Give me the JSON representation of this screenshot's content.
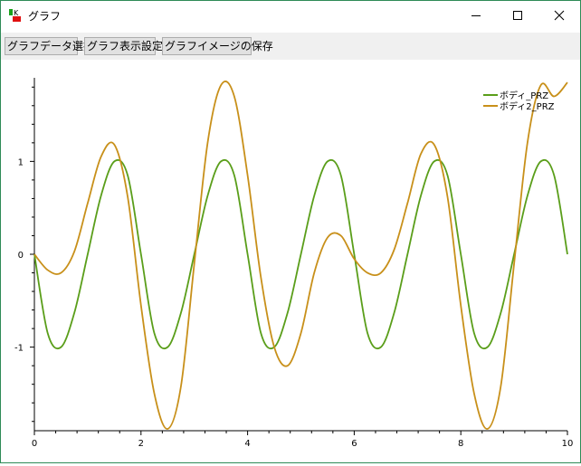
{
  "window": {
    "title": "グラフ",
    "controls": {
      "minimize_icon": "minimize-icon",
      "maximize_icon": "maximize-icon",
      "close_icon": "close-icon"
    }
  },
  "toolbar": {
    "select_data_label": "グラフデータ選択",
    "display_settings_label": "グラフ表示設定",
    "save_image_label": "グラフイメージの保存"
  },
  "colors": {
    "accent_border": "#2e8b57",
    "series1": "#5a9e1a",
    "series2": "#c8901a"
  },
  "chart_data": {
    "type": "line",
    "title": "",
    "xlabel": "",
    "ylabel": "",
    "xlim": [
      0,
      10
    ],
    "ylim": [
      -1.9,
      1.9
    ],
    "x_ticks": [
      "0",
      "2",
      "4",
      "6",
      "8",
      "10"
    ],
    "y_ticks": [
      "1",
      "0",
      "-1"
    ],
    "grid": false,
    "legend_position": "top-right",
    "x": [
      0,
      0.25,
      0.5,
      0.75,
      1,
      1.25,
      1.5,
      1.75,
      2,
      2.25,
      2.5,
      2.75,
      3,
      3.25,
      3.5,
      3.75,
      4,
      4.25,
      4.5,
      4.75,
      5,
      5.25,
      5.5,
      5.75,
      6,
      6.25,
      6.5,
      6.75,
      7,
      7.25,
      7.5,
      7.75,
      8,
      8.25,
      8.5,
      8.75,
      9,
      9.25,
      9.5,
      9.75,
      10
    ],
    "series": [
      {
        "name": "ボディ_PRZ",
        "values": [
          0,
          -0.85,
          -1.0,
          -0.63,
          0.0,
          0.63,
          1.0,
          0.85,
          0.0,
          -0.85,
          -1.0,
          -0.63,
          0.0,
          0.63,
          1.0,
          0.85,
          0.0,
          -0.85,
          -1.0,
          -0.63,
          0.0,
          0.63,
          1.0,
          0.85,
          0.0,
          -0.85,
          -1.0,
          -0.63,
          0.0,
          0.63,
          1.0,
          0.85,
          0.0,
          -0.85,
          -1.0,
          -0.63,
          0.0,
          0.63,
          1.0,
          0.85,
          0.0
        ]
      },
      {
        "name": "ボディ2_PRZ",
        "values": [
          0,
          -0.17,
          -0.2,
          0.03,
          0.55,
          1.05,
          1.18,
          0.62,
          -0.55,
          -1.5,
          -1.88,
          -1.42,
          -0.1,
          1.2,
          1.82,
          1.7,
          0.85,
          -0.25,
          -1.0,
          -1.2,
          -0.85,
          -0.2,
          0.18,
          0.2,
          -0.05,
          -0.2,
          -0.2,
          0.05,
          0.55,
          1.08,
          1.18,
          0.62,
          -0.55,
          -1.5,
          -1.88,
          -1.42,
          -0.1,
          1.2,
          1.82,
          1.7,
          1.85
        ]
      }
    ]
  }
}
